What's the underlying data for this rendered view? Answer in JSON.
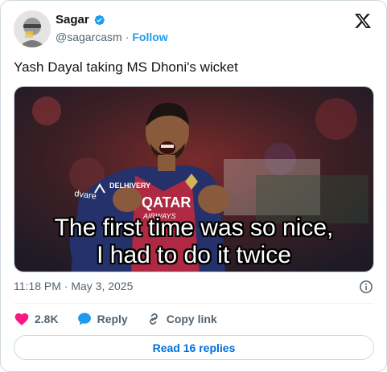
{
  "author": {
    "display_name": "Sagar",
    "handle": "@sagarcasm",
    "follow_label": "Follow",
    "separator": "·"
  },
  "tweet": {
    "text": "Yash Dayal taking MS Dhoni's wicket",
    "media_caption_line1": "The first time was so nice,",
    "media_caption_line2": "I had to do it twice",
    "jersey_text_1": "DELHIVERY",
    "jersey_text_2": "QATAR",
    "jersey_text_3": "AIRWAYS",
    "jersey_sleeve": "dvare",
    "timestamp": "11:18 PM · May 3, 2025"
  },
  "actions": {
    "like_count": "2.8K",
    "reply_label": "Reply",
    "copy_link_label": "Copy link"
  },
  "footer": {
    "read_replies_label": "Read 16 replies"
  },
  "colors": {
    "accent": "#1d9bf0",
    "like": "#f91880",
    "muted": "#536471",
    "text": "#0f1419"
  },
  "icons": [
    "verified-badge-icon",
    "x-logo-icon",
    "info-icon",
    "heart-icon",
    "reply-bubble-icon",
    "link-icon"
  ]
}
